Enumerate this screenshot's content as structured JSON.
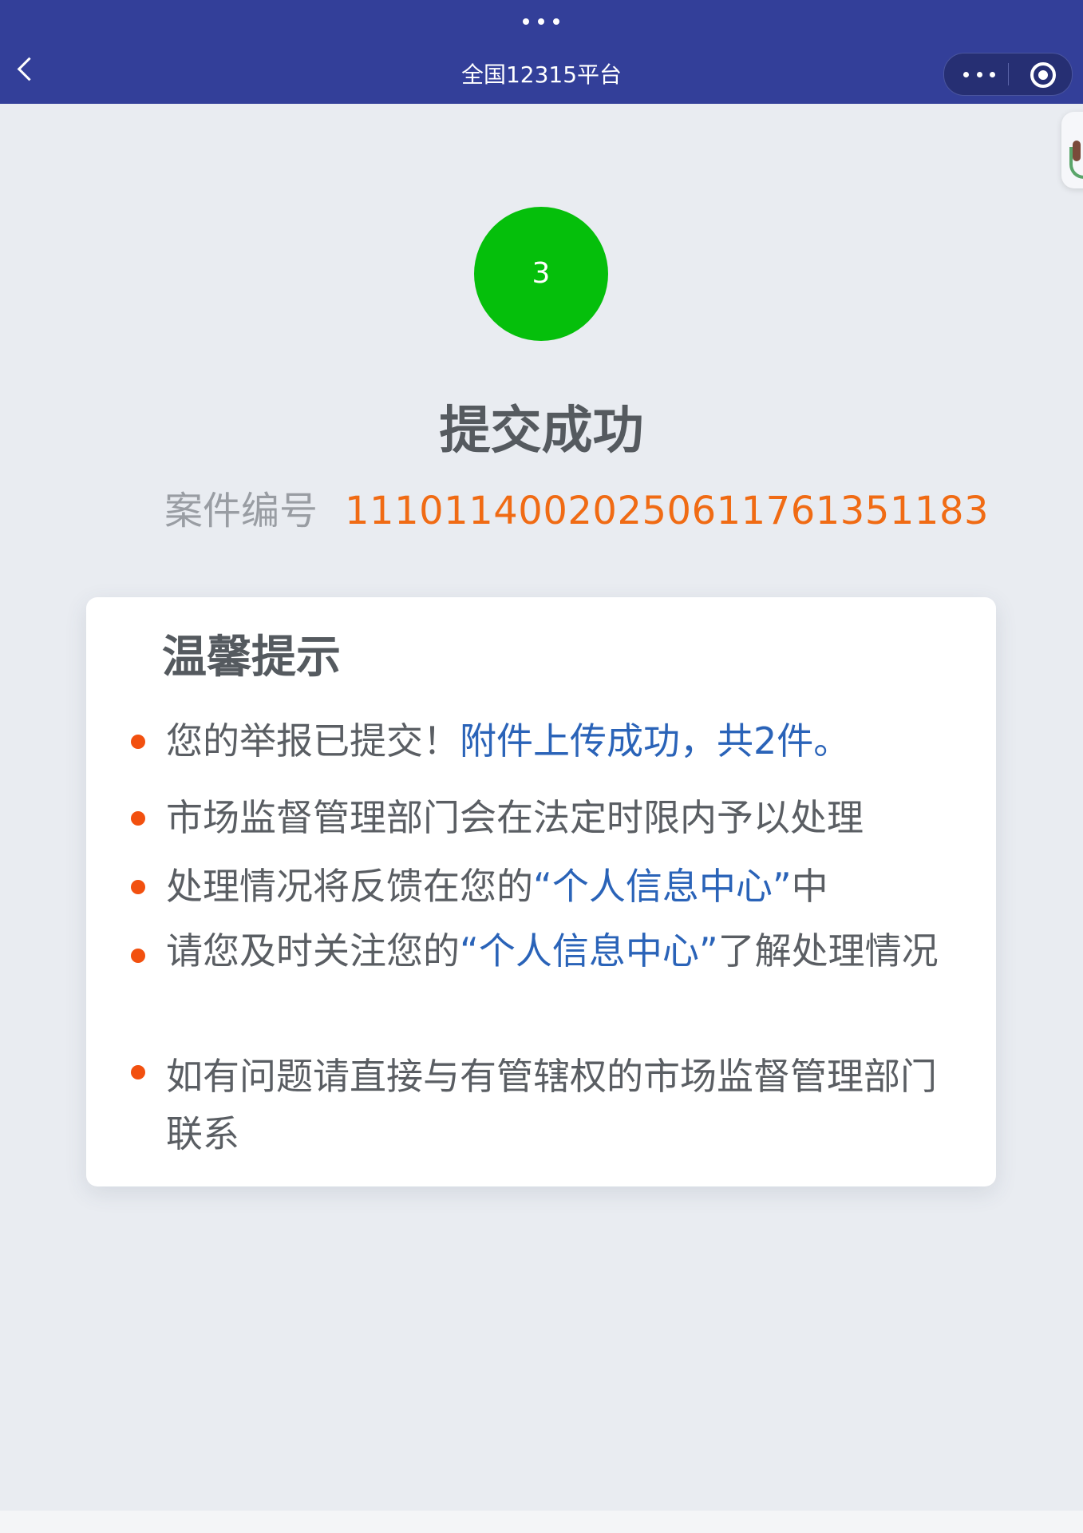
{
  "nav": {
    "title": "全国12315平台",
    "back_icon": "chevron-left-icon",
    "menu_icon": "more-dots-icon",
    "close_icon": "target-circle-icon",
    "background_color": "#333f99"
  },
  "step": {
    "number": "3",
    "color": "#05bf0b"
  },
  "result": {
    "title": "提交成功",
    "case_label": "案件编号",
    "case_number": "11101140020250611761351183",
    "case_number_color": "#f06b14"
  },
  "tips": {
    "title": "温馨提示",
    "bullet_color": "#f2500f",
    "items": [
      {
        "part1": "您的举报已提交！",
        "highlight": "附件上传成功，共2件。",
        "part2": ""
      },
      {
        "part1": "市场监督管理部门会在法定时限内予以处理",
        "highlight": "",
        "part2": ""
      },
      {
        "part1": "处理情况将反馈在您的",
        "highlight": "“个人信息中心”",
        "part2": "中"
      },
      {
        "part1": "请您及时关注您的",
        "highlight": "“个人信息中心”",
        "part2": "了解处理情况"
      },
      {
        "part1": "如有问题请直接与有管辖权的市场监督管理部门联系",
        "highlight": "",
        "part2": ""
      }
    ]
  }
}
